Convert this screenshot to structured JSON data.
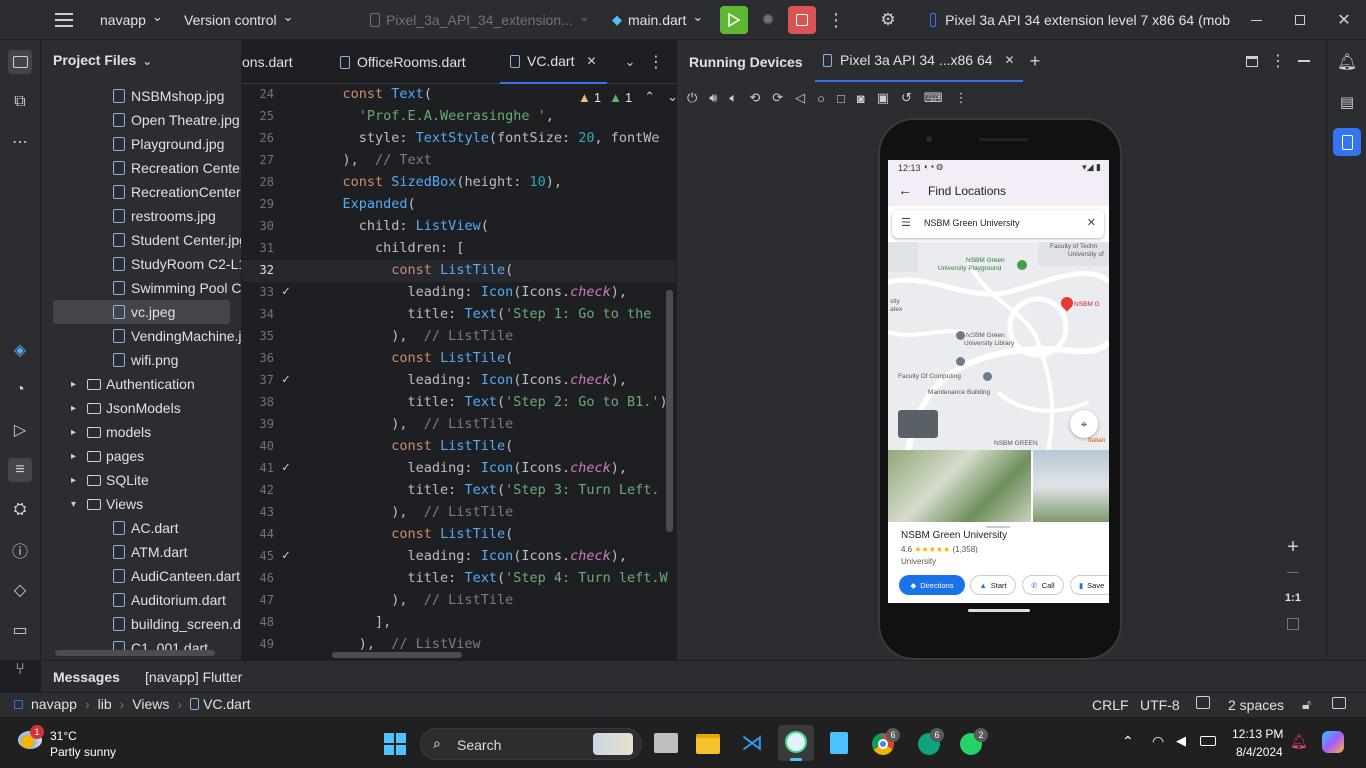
{
  "titlebar": {
    "project": "navapp",
    "vcs": "Version control",
    "device_config": "Pixel_3a_API_34_extension...",
    "run_config": "main.dart",
    "device_selector": "Pixel 3a API 34 extension level 7 x86 64 (mob"
  },
  "project_panel": {
    "title": "Project Files",
    "items": [
      {
        "type": "file",
        "label": "NSBMshop.jpg"
      },
      {
        "type": "file",
        "label": "Open Theatre.jpg"
      },
      {
        "type": "file",
        "label": "Playground.jpg"
      },
      {
        "type": "file",
        "label": "Recreation Center"
      },
      {
        "type": "file",
        "label": "RecreationCenter2"
      },
      {
        "type": "file",
        "label": "restrooms.jpg"
      },
      {
        "type": "file",
        "label": "Student Center.jpg"
      },
      {
        "type": "file",
        "label": "StudyRoom C2-L11"
      },
      {
        "type": "file",
        "label": "Swimming Pool Co"
      },
      {
        "type": "file",
        "label": "vc.jpeg",
        "selected": true
      },
      {
        "type": "file",
        "label": "VendingMachine.jp"
      },
      {
        "type": "file",
        "label": "wifi.png"
      },
      {
        "type": "folder",
        "label": "Authentication"
      },
      {
        "type": "folder",
        "label": "JsonModels"
      },
      {
        "type": "folder",
        "label": "models"
      },
      {
        "type": "folder",
        "label": "pages"
      },
      {
        "type": "folder",
        "label": "SQLite"
      },
      {
        "type": "folder-open",
        "label": "Views"
      },
      {
        "type": "dart",
        "label": "AC.dart"
      },
      {
        "type": "dart",
        "label": "ATM.dart"
      },
      {
        "type": "dart",
        "label": "AudiCanteen.dart"
      },
      {
        "type": "dart",
        "label": "Auditorium.dart"
      },
      {
        "type": "dart",
        "label": "building_screen.da"
      },
      {
        "type": "dart",
        "label": "C1_001.dart"
      }
    ]
  },
  "editor": {
    "tabs": [
      {
        "label": "ons.dart"
      },
      {
        "label": "OfficeRooms.dart"
      },
      {
        "label": "VC.dart",
        "active": true
      }
    ],
    "inspection": {
      "warnings": "1",
      "weak": "1"
    },
    "lines": [
      {
        "n": "24",
        "html": "    <span class='kw'>const</span> <span class='ty'>Text</span>("
      },
      {
        "n": "25",
        "html": "      <span class='str'>'Prof.E.A.Weerasinghe '</span>,"
      },
      {
        "n": "26",
        "html": "      style: <span class='ty'>TextStyle</span>(fontSize: <span class='num'>20</span>, fontWe"
      },
      {
        "n": "27",
        "html": "    ),  <span class='cm'>// Text</span>"
      },
      {
        "n": "28",
        "html": "    <span class='kw'>const</span> <span class='ty'>SizedBox</span>(height: <span class='num'>10</span>),"
      },
      {
        "n": "29",
        "html": "    <span class='ty'>Expanded</span>("
      },
      {
        "n": "30",
        "html": "      child: <span class='ty'>ListView</span>("
      },
      {
        "n": "31",
        "html": "        children: ["
      },
      {
        "n": "32",
        "html": "          <span class='kw'>const</span> <span class='ty'>ListTile</span>(",
        "cur": true
      },
      {
        "n": "33",
        "html": "            leading: <span class='ty'>Icon</span>(Icons.<span class='it'>check</span>),",
        "check": true
      },
      {
        "n": "34",
        "html": "            title: <span class='ty'>Text</span>(<span class='str'>'Step 1: Go to the </span>"
      },
      {
        "n": "35",
        "html": "          ),  <span class='cm'>// ListTile</span>"
      },
      {
        "n": "36",
        "html": "          <span class='kw'>const</span> <span class='ty'>ListTile</span>("
      },
      {
        "n": "37",
        "html": "            leading: <span class='ty'>Icon</span>(Icons.<span class='it'>check</span>),",
        "check": true
      },
      {
        "n": "38",
        "html": "            title: <span class='ty'>Text</span>(<span class='str'>'Step 2: Go to B1.'</span>)"
      },
      {
        "n": "39",
        "html": "          ),  <span class='cm'>// ListTile</span>"
      },
      {
        "n": "40",
        "html": "          <span class='kw'>const</span> <span class='ty'>ListTile</span>("
      },
      {
        "n": "41",
        "html": "            leading: <span class='ty'>Icon</span>(Icons.<span class='it'>check</span>),",
        "check": true
      },
      {
        "n": "42",
        "html": "            title: <span class='ty'>Text</span>(<span class='str'>'Step 3: Turn Left.</span>"
      },
      {
        "n": "43",
        "html": "          ),  <span class='cm'>// ListTile</span>"
      },
      {
        "n": "44",
        "html": "          <span class='kw'>const</span> <span class='ty'>ListTile</span>("
      },
      {
        "n": "45",
        "html": "            leading: <span class='ty'>Icon</span>(Icons.<span class='it'>check</span>),",
        "check": true
      },
      {
        "n": "46",
        "html": "            title: <span class='ty'>Text</span>(<span class='str'>'Step 4: Turn left.W</span>"
      },
      {
        "n": "47",
        "html": "          ),  <span class='cm'>// ListTile</span>"
      },
      {
        "n": "48",
        "html": "        ],"
      },
      {
        "n": "49",
        "html": "      ),  <span class='cm'>// ListView</span>"
      }
    ]
  },
  "devices": {
    "title": "Running Devices",
    "tab": "Pixel 3a API 34 ...x86 64",
    "zoom_label": "1:1"
  },
  "phone": {
    "time": "12:13",
    "app_title": "Find Locations",
    "search_value": "NSBM Green University",
    "map_labels": [
      "Faculty of Techn",
      "University of",
      "NSBM Green",
      "University Playground",
      "NSBM G",
      "NSBM Green",
      "University Library",
      "Faculty Of Computing",
      "Maintenance Building",
      "NSBM GREEN",
      "Italian",
      "sity",
      "atex"
    ],
    "place_name": "NSBM Green University",
    "rating": "4.6",
    "stars": "★★★★★",
    "reviews": "(1,358)",
    "category": "University",
    "actions": [
      "Directions",
      "Start",
      "Call",
      "Save"
    ]
  },
  "bottom": {
    "messages_tab": "Messages",
    "flutter_tab": "[navapp] Flutter",
    "breadcrumb": [
      "navapp",
      "lib",
      "Views",
      "VC.dart"
    ],
    "line_sep": "CRLF",
    "encoding": "UTF-8",
    "indent": "2 spaces"
  },
  "taskbar": {
    "weather_temp": "31°C",
    "weather_desc": "Partly sunny",
    "weather_badge": "1",
    "search": "Search",
    "time": "12:13 PM",
    "date": "8/4/2024",
    "badges": {
      "chrome": "6",
      "chatgpt": "6",
      "whatsapp": "2"
    }
  },
  "colors": {
    "accent": "#3574f0",
    "run_green": "#5fb832",
    "stop_red": "#d95555",
    "ide_bg": "#2b2d30"
  }
}
